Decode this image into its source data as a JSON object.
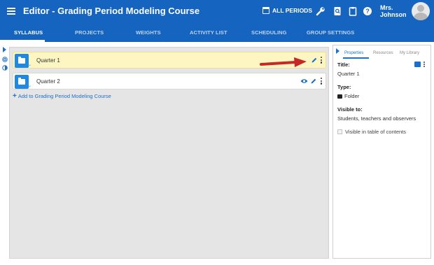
{
  "header": {
    "title": "Editor - Grading Period Modeling Course",
    "periods_label": "ALL PERIODS",
    "user_name_line1": "Mrs.",
    "user_name_line2": "Johnson",
    "color": "#1565c0"
  },
  "tabs": [
    {
      "label": "SYLLABUS",
      "active": true
    },
    {
      "label": "PROJECTS",
      "active": false
    },
    {
      "label": "WEIGHTS",
      "active": false
    },
    {
      "label": "ACTIVITY LIST",
      "active": false
    },
    {
      "label": "SCHEDULING",
      "active": false
    },
    {
      "label": "GROUP SETTINGS",
      "active": false
    }
  ],
  "items": [
    {
      "title": "Quarter 1",
      "highlighted": true,
      "icons": [
        "pencil-icon",
        "more-vert-icon"
      ]
    },
    {
      "title": "Quarter 2",
      "highlighted": false,
      "icons": [
        "eye-icon",
        "pencil-icon",
        "more-vert-icon"
      ]
    }
  ],
  "add_link": {
    "plus": "+",
    "label": "Add to Grading Period Modeling Course"
  },
  "panel": {
    "tabs": [
      "Properties",
      "Resources",
      "My Library"
    ],
    "active_tab": "Properties",
    "title_label": "Title:",
    "title_value": "Quarter 1",
    "type_label": "Type:",
    "type_value": "Folder",
    "visible_label": "Visible to:",
    "visible_value": "Students, teachers and observers",
    "checkbox_label": "Visible in table of contents",
    "checkbox_checked": true
  },
  "colors": {
    "accent": "#1e88e5",
    "highlight": "#fdf6c3",
    "arrow": "#c62828"
  }
}
